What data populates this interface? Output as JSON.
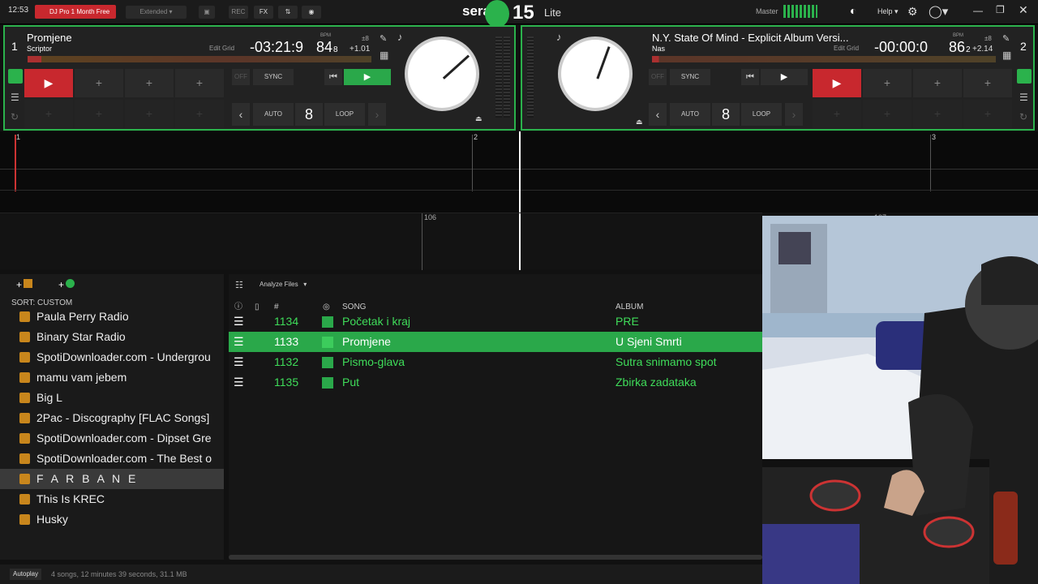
{
  "topbar": {
    "clock": "12:53",
    "promo": "DJ Pro 1 Month Free",
    "extended": "Extended",
    "rec": "REC",
    "fx": "FX",
    "logo_left": "sera",
    "logo_num": "15",
    "logo_right": "Lite",
    "master": "Master",
    "help": "Help"
  },
  "deck1": {
    "number": "1",
    "title": "Promjene",
    "artist": "Scriptor",
    "edit_grid": "Edit Grid",
    "time": "-03:21:9",
    "bpm_label": "BPM",
    "bpm": "84",
    "bpm_dec": "8",
    "pitch_range": "±8",
    "pitch": "+1.01",
    "off": "OFF",
    "sync": "SYNC",
    "auto": "AUTO",
    "loop_len": "8",
    "loop": "LOOP",
    "pad_add": "+"
  },
  "deck2": {
    "number": "2",
    "title": "N.Y. State Of Mind - Explicit Album Versi...",
    "artist": "Nas",
    "edit_grid": "Edit Grid",
    "time": "-00:00:0",
    "bpm_label": "BPM",
    "bpm": "86",
    "bpm_dec": "2",
    "pitch_range": "±8",
    "pitch": "+2.14",
    "off": "OFF",
    "sync": "SYNC",
    "auto": "AUTO",
    "loop_len": "8",
    "loop": "LOOP",
    "pad_add": "+"
  },
  "waveform": {
    "bar1": "1",
    "bar2": "2",
    "bar3": "3",
    "beat_a": "106",
    "beat_b": "107"
  },
  "library": {
    "add_crate": "+",
    "sort": "SORT: CUSTOM",
    "crates": [
      "Paula Perry Radio",
      "Binary Star Radio",
      "SpotiDownloader.com - Undergrou",
      "mamu vam jebem",
      "Big L",
      "2Pac - Discography [FLAC Songs]",
      "SpotiDownloader.com - Dipset Gre",
      "SpotiDownloader.com - The Best o",
      "F A R B A N E",
      "This Is KREC",
      "Husky"
    ],
    "selected_crate_index": 8,
    "analyze": "Analyze Files",
    "columns": {
      "num": "#",
      "song": "SONG",
      "album": "ALBUM"
    },
    "tracks": [
      {
        "num": "1134",
        "song": "Početak i kraj",
        "album": "PRE"
      },
      {
        "num": "1133",
        "song": "Promjene",
        "album": "U Sjeni Smrti"
      },
      {
        "num": "1132",
        "song": "Pismo-glava",
        "album": "Sutra snimamo spot"
      },
      {
        "num": "1135",
        "song": "Put",
        "album": "Zbirka zadataka"
      }
    ],
    "selected_track_index": 1,
    "autoplay": "Autoplay",
    "status": "4 songs, 12 minutes 39 seconds, 31.1 MB"
  },
  "colors": {
    "accent": "#2bb24c",
    "cue_red": "#c8282e",
    "play_green": "#2aa84a"
  }
}
